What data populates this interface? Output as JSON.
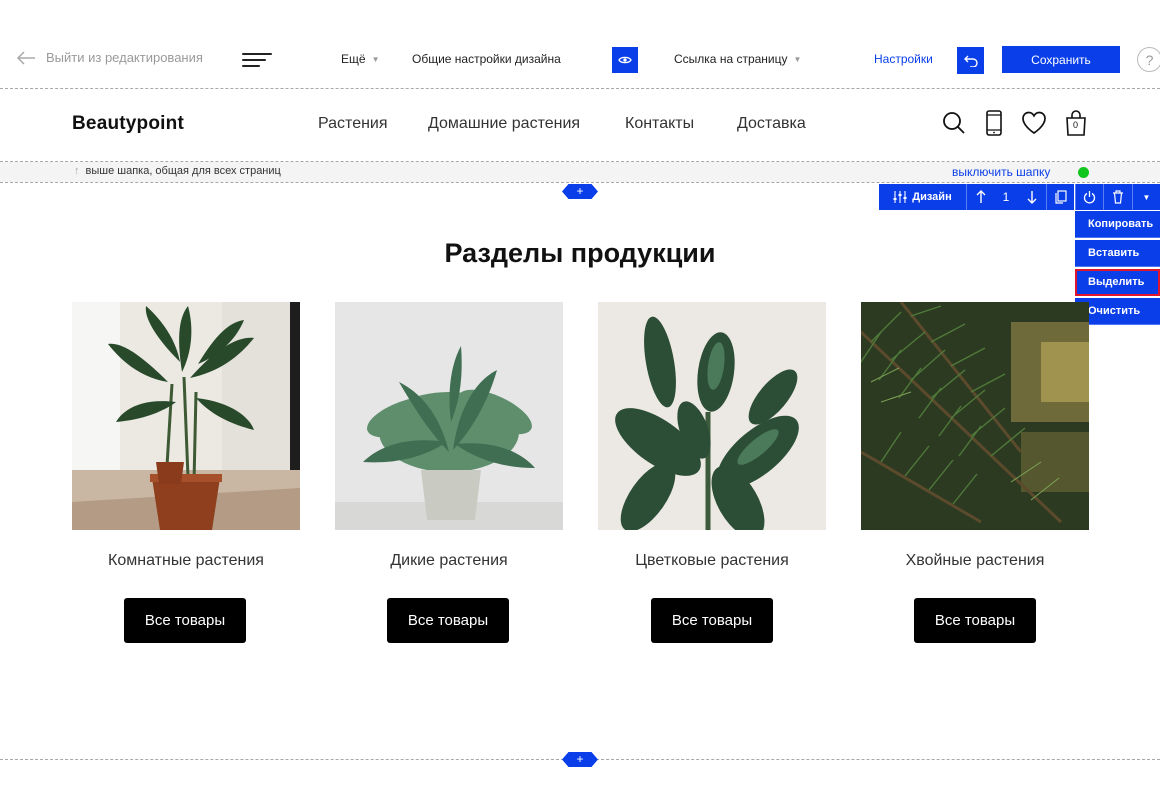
{
  "toolbar": {
    "exit_label": "Выйти из редактирования",
    "more_label": "Ещё",
    "design_settings_label": "Общие настройки дизайна",
    "page_link_label": "Ссылка на страницу",
    "settings_label": "Настройки",
    "save_label": "Сохранить",
    "help_label": "?"
  },
  "header": {
    "logo": "Beautypoint",
    "nav": [
      "Растения",
      "Домашние растения",
      "Контакты",
      "Доставка"
    ],
    "cart_count": "0",
    "note": "выше шапка, общая для всех страниц",
    "disable_label": "выключить шапку"
  },
  "block_controls": {
    "design_label": "Дизайн",
    "position": "1",
    "add_symbol": "+",
    "menu": [
      "Копировать",
      "Вставить",
      "Выделить",
      "Очистить"
    ],
    "active_menu_item": "Выделить"
  },
  "section": {
    "title": "Разделы продукции",
    "categories": [
      {
        "title": "Комнатные растения",
        "button": "Все товары"
      },
      {
        "title": "Дикие растения",
        "button": "Все товары"
      },
      {
        "title": "Цветковые растения",
        "button": "Все товары"
      },
      {
        "title": "Хвойные растения",
        "button": "Все товары"
      }
    ]
  },
  "colors": {
    "accent": "#0a3ee9",
    "status": "#12c51f",
    "highlight": "#e0142d"
  }
}
